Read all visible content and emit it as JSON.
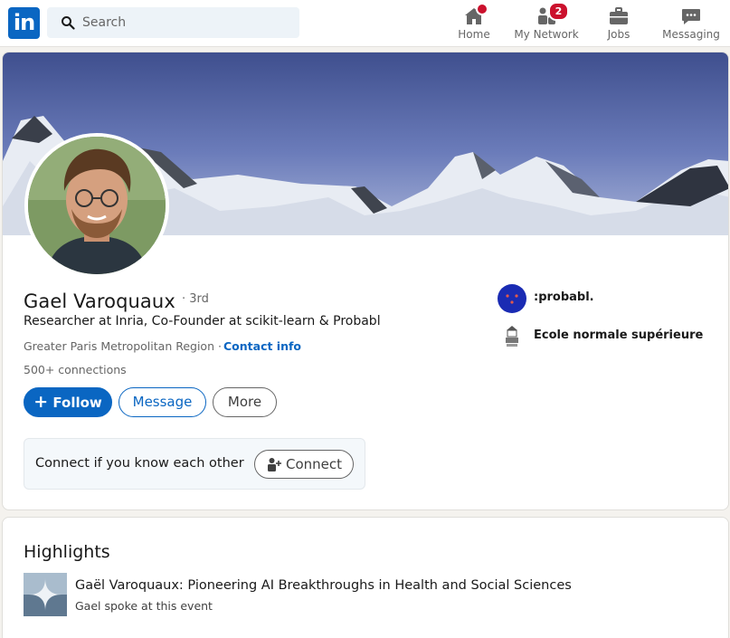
{
  "nav": {
    "search_placeholder": "Search",
    "items": [
      {
        "label": "Home",
        "icon": "home-icon",
        "badge": ""
      },
      {
        "label": "My Network",
        "icon": "network-icon",
        "badge": "2"
      },
      {
        "label": "Jobs",
        "icon": "briefcase-icon",
        "badge": ""
      },
      {
        "label": "Messaging",
        "icon": "chat-icon",
        "badge": ""
      }
    ]
  },
  "profile": {
    "name": "Gael Varoquaux",
    "degree": "· 3rd",
    "headline": "Researcher at Inria, Co-Founder at scikit-learn & Probabl",
    "location": "Greater Paris Metropolitan Region ·",
    "contact_info": "Contact info",
    "connections": "500+ connections",
    "follow_label": "Follow",
    "message_label": "Message",
    "more_label": "More",
    "connect_prompt": "Connect if you know each other",
    "connect_label": "Connect",
    "orgs": [
      {
        "name": ":probabl."
      },
      {
        "name": "Ecole normale supérieure"
      }
    ]
  },
  "highlights": {
    "title": "Highlights",
    "item_title": "Gaël Varoquaux: Pioneering AI Breakthroughs in Health and Social Sciences",
    "item_sub": "Gael spoke at this event"
  },
  "colors": {
    "brand": "#0a66c2",
    "badge": "#cb112d"
  }
}
